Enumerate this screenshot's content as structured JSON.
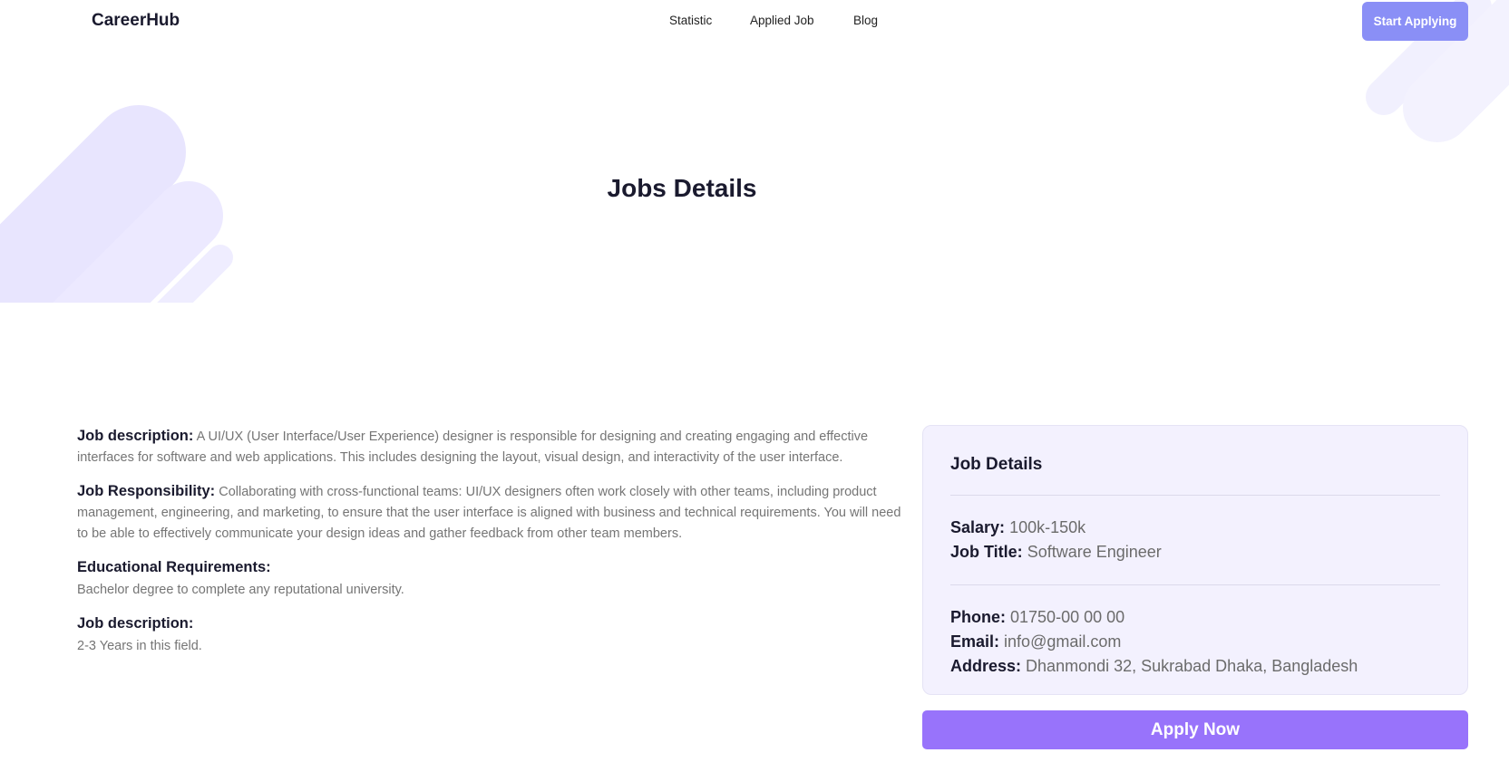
{
  "brand": {
    "name": "CareerHub"
  },
  "nav": {
    "links": [
      "Statistic",
      "Applied Job",
      "Blog"
    ],
    "cta_label": "Start Applying"
  },
  "hero": {
    "title": "Jobs Details"
  },
  "details": {
    "description_label": "Job description:",
    "description_text": "A UI/UX (User Interface/User Experience) designer is responsible for designing and creating engaging and effective interfaces for software and web applications. This includes designing the layout, visual design, and interactivity of the user interface.",
    "responsibility_label": "Job Responsibility:",
    "responsibility_text": "Collaborating with cross-functional teams: UI/UX designers often work closely with other teams, including product management, engineering, and marketing, to ensure that the user interface is aligned with business and technical requirements. You will need to be able to effectively communicate your design ideas and gather feedback from other team members.",
    "education_label": "Educational Requirements:",
    "education_text": "Bachelor degree to complete any reputational university.",
    "experience_label": "Job description:",
    "experience_text": "2-3 Years in this field."
  },
  "card": {
    "title": "Job Details",
    "salary_label": "Salary:",
    "salary_value": "100k-150k",
    "job_title_label": "Job Title:",
    "job_title_value": "Software Engineer",
    "phone_label": "Phone:",
    "phone_value": "01750-00 00 00",
    "email_label": "Email:",
    "email_value": "info@gmail.com",
    "address_label": "Address:",
    "address_value": "Dhanmondi 32, Sukrabad Dhaka, Bangladesh"
  },
  "apply_label": "Apply Now",
  "colors": {
    "accent": "#9873fb",
    "cta": "#8a8ff6",
    "card_bg": "#f3f1fe",
    "decor": "#ece9ff"
  }
}
